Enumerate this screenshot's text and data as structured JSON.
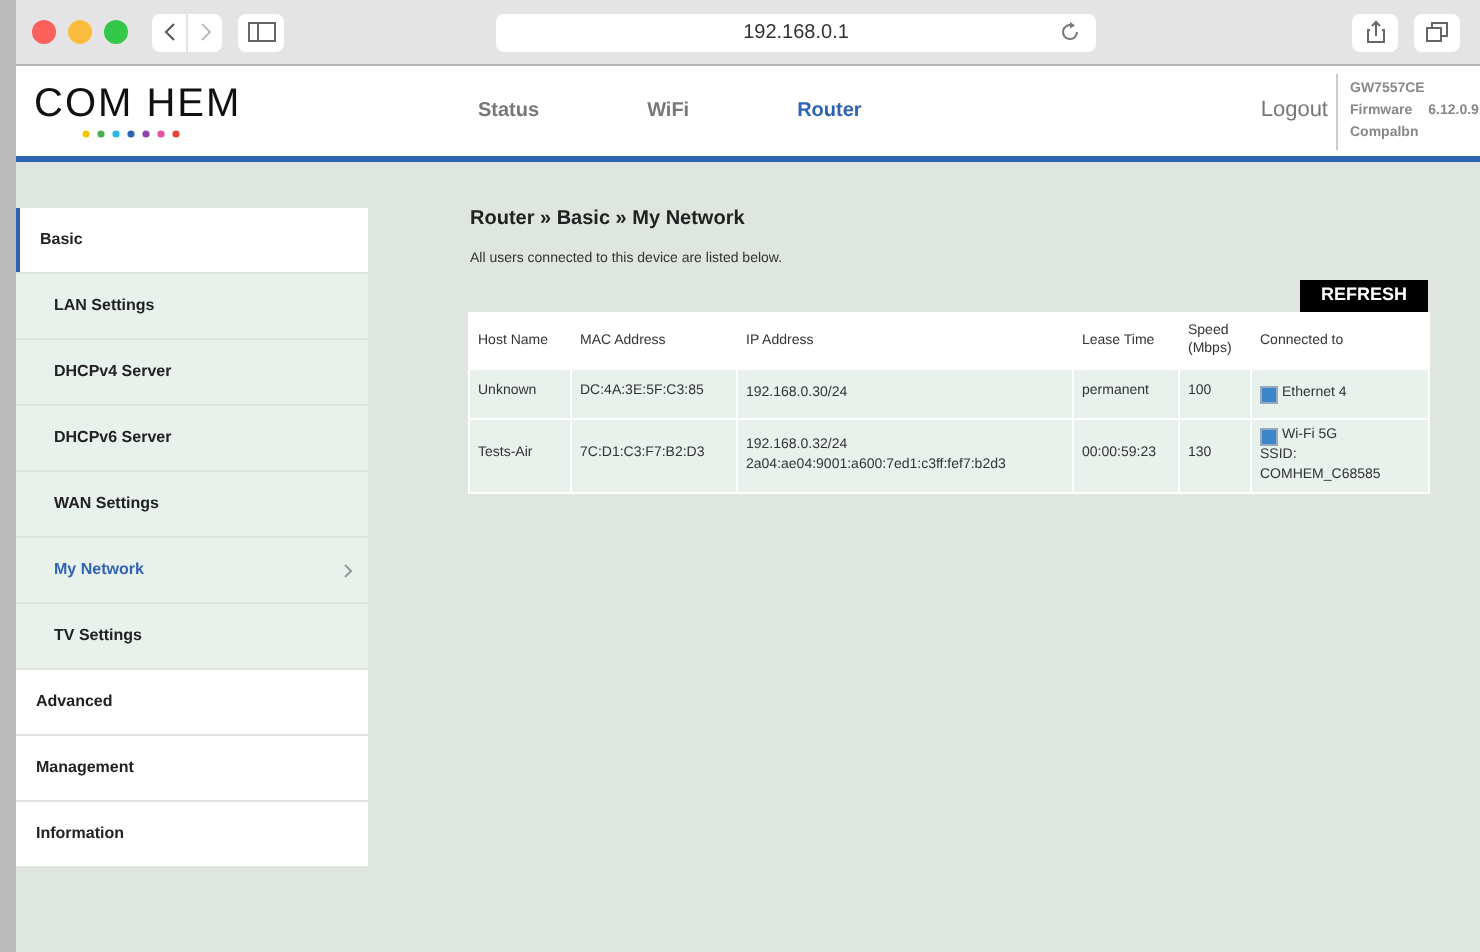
{
  "browser": {
    "url": "192.168.0.1"
  },
  "header": {
    "logo": "COM HEM",
    "nav": [
      {
        "label": "Status",
        "selected": false
      },
      {
        "label": "WiFi",
        "selected": false
      },
      {
        "label": "Router",
        "selected": true
      }
    ],
    "logout": "Logout",
    "device": {
      "model": "GW7557CE",
      "firmware_label": "Firmware",
      "firmware_version": "6.12.0.9",
      "vendor": "Compalbn"
    }
  },
  "sidebar": {
    "sections": [
      {
        "label": "Basic",
        "expanded": true,
        "children": [
          {
            "label": "LAN Settings",
            "selected": false
          },
          {
            "label": "DHCPv4 Server",
            "selected": false
          },
          {
            "label": "DHCPv6 Server",
            "selected": false
          },
          {
            "label": "WAN Settings",
            "selected": false
          },
          {
            "label": "My Network",
            "selected": true
          },
          {
            "label": "TV Settings",
            "selected": false
          }
        ]
      },
      {
        "label": "Advanced",
        "expanded": false
      },
      {
        "label": "Management",
        "expanded": false
      },
      {
        "label": "Information",
        "expanded": false
      }
    ]
  },
  "main": {
    "breadcrumb": "Router » Basic » My Network",
    "description": "All users connected to this device are listed below.",
    "refresh_button": "REFRESH",
    "table": {
      "columns": [
        "Host Name",
        "MAC Address",
        "IP Address",
        "Lease Time",
        "Speed (Mbps)",
        "Connected to"
      ],
      "rows": [
        {
          "host": "Unknown",
          "mac": "DC:4A:3E:5F:C3:85",
          "ip": [
            "192.168.0.30/24"
          ],
          "lease": "permanent",
          "speed": "100",
          "connected": [
            "Ethernet 4"
          ]
        },
        {
          "host": "Tests-Air",
          "mac": "7C:D1:C3:F7:B2:D3",
          "ip": [
            "192.168.0.32/24",
            "2a04:ae04:9001:a600:7ed1:c3ff:fef7:b2d3"
          ],
          "lease": "00:00:59:23",
          "speed": "130",
          "connected": [
            "Wi-Fi 5G",
            "SSID:",
            "COMHEM_C68585"
          ]
        }
      ]
    }
  }
}
